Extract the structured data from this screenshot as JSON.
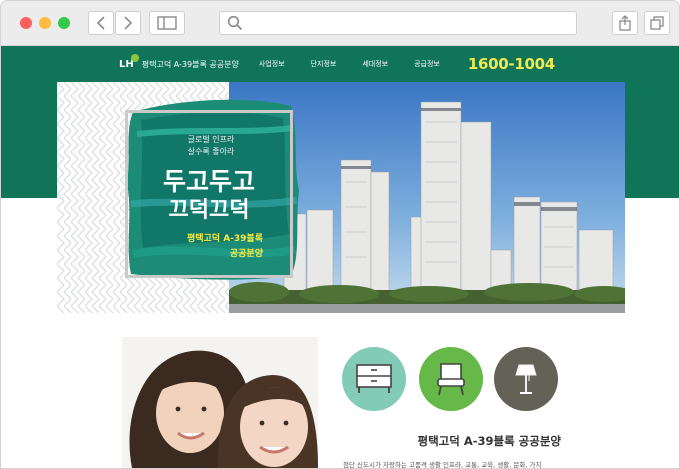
{
  "nav": {
    "logo_text": "LH",
    "site_title": "평택고덕 A-39블록 공공분양",
    "links": [
      "사업정보",
      "단지정보",
      "세대정보",
      "공급정보"
    ],
    "phone": "1600-1004"
  },
  "hero": {
    "line1": "글로벌 인프라",
    "line2": "살수록 좋아라",
    "headline1": "두고두고",
    "headline2": "끄덕끄덕",
    "sub1": "평택고덕 A-39블록",
    "sub2": "공공분양"
  },
  "info": {
    "title": "평택고덕 A-39블록 공공분양",
    "body": "첨단 신도시가 자랑하는 고품격 생활 인프라, 교통, 교육, 생활, 문화, 가치"
  },
  "colors": {
    "brand_green": "#0f7458",
    "phone_yellow": "#f2e94e",
    "icon_mint": "#82cbb7",
    "icon_green": "#66b848",
    "icon_gray": "#646157"
  },
  "icons": {
    "circle1": "cabinet-icon",
    "circle2": "chair-icon",
    "circle3": "floor-lamp-icon"
  }
}
